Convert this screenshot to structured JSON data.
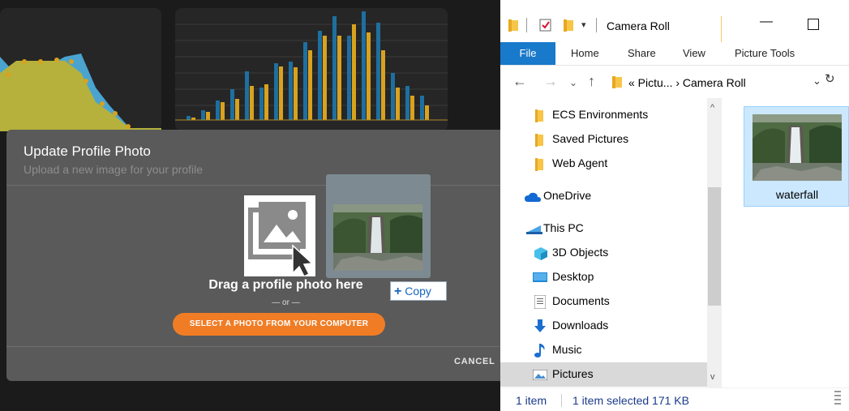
{
  "dashboard": {
    "chart_bars_blue": [
      5,
      12,
      24,
      38,
      60,
      40,
      70,
      72,
      96,
      110,
      128,
      104,
      134,
      120,
      58,
      42,
      30
    ],
    "chart_bars_gold": [
      3,
      10,
      22,
      26,
      42,
      44,
      66,
      65,
      86,
      104,
      104,
      118,
      108,
      86,
      40,
      30,
      18
    ],
    "colors": {
      "blue": "#1e6fa0",
      "gold": "#d9a21e",
      "area_blue": "#4aa4cf",
      "area_olive": "#b5b13c"
    }
  },
  "modal": {
    "title": "Update Profile Photo",
    "subtitle": "Upload a new image for your profile",
    "drag_text": "Drag a profile photo here",
    "or_text": "— or —",
    "select_button": "SELECT A PHOTO FROM YOUR COMPUTER",
    "cancel_button": "CANCEL",
    "accent": "#f07d25"
  },
  "drag_tooltip": {
    "symbol": "+",
    "label": "Copy"
  },
  "explorer": {
    "window_title": "Camera Roll",
    "ribbon_tabs": [
      "File",
      "Home",
      "Share",
      "View",
      "Picture Tools"
    ],
    "address_path": "« Pictu...  ›  Camera Roll",
    "nav_items": [
      {
        "label": "ECS Environments",
        "icon": "folder-icon"
      },
      {
        "label": "Saved Pictures",
        "icon": "folder-icon"
      },
      {
        "label": "Web Agent",
        "icon": "folder-icon"
      },
      {
        "label": "OneDrive",
        "icon": "cloud-icon"
      },
      {
        "label": "This PC",
        "icon": "computer-icon"
      },
      {
        "label": "3D Objects",
        "icon": "cube-icon"
      },
      {
        "label": "Desktop",
        "icon": "desktop-icon"
      },
      {
        "label": "Documents",
        "icon": "document-icon"
      },
      {
        "label": "Downloads",
        "icon": "download-icon"
      },
      {
        "label": "Music",
        "icon": "music-icon"
      },
      {
        "label": "Pictures",
        "icon": "pictures-icon"
      }
    ],
    "file": {
      "name": "waterfall"
    },
    "status": {
      "count": "1 item",
      "selection": "1 item selected  171 KB"
    }
  }
}
